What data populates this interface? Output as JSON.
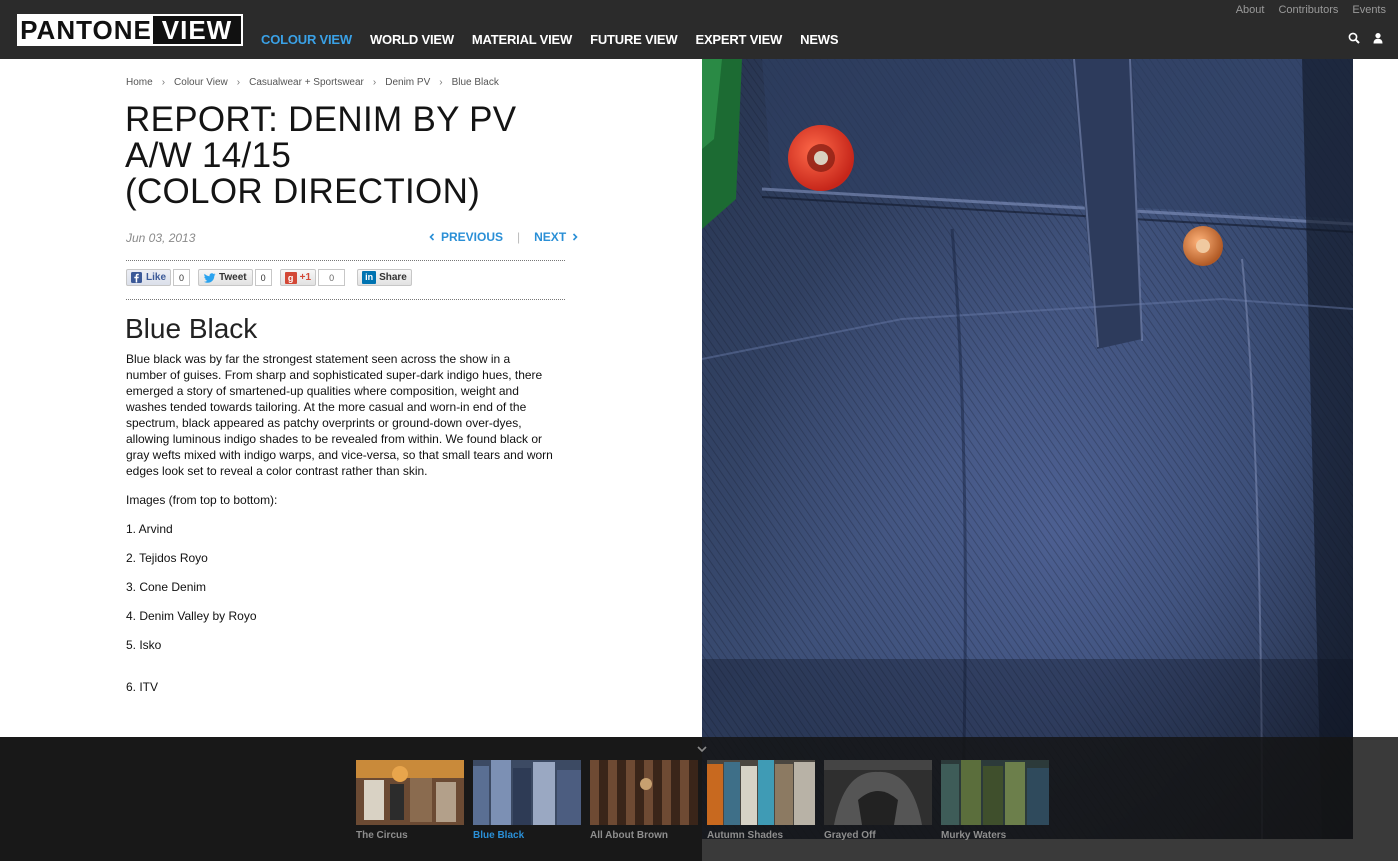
{
  "header": {
    "logo_left": "PANTONE",
    "logo_right": "VIEW",
    "nav": [
      {
        "label": "COLOUR VIEW",
        "active": true
      },
      {
        "label": "WORLD VIEW",
        "active": false
      },
      {
        "label": "MATERIAL VIEW",
        "active": false
      },
      {
        "label": "FUTURE VIEW",
        "active": false
      },
      {
        "label": "EXPERT VIEW",
        "active": false
      },
      {
        "label": "NEWS",
        "active": false
      }
    ],
    "util": [
      "About",
      "Contributors",
      "Events"
    ],
    "icons": [
      "search-icon",
      "user-icon"
    ]
  },
  "breadcrumb": [
    "Home",
    "Colour View",
    "Casualwear + Sportswear",
    "Denim PV",
    "Blue Black"
  ],
  "article": {
    "title_lines": [
      "REPORT: DENIM BY PV",
      "A/W 14/15",
      "(COLOR DIRECTION)"
    ],
    "date": "Jun 03, 2013",
    "previous_label": "PREVIOUS",
    "next_label": "NEXT",
    "section_title": "Blue Black",
    "body": "Blue black was by far the strongest statement seen across the show in a number of guises. From sharp and sophisticated super-dark indigo hues, there emerged a story of smartened-up qualities where composition, weight and washes tended towards tailoring. At the more casual and worn-in end of the spectrum, black appeared as patchy overprints or ground-down over-dyes, allowing luminous indigo shades to be revealed from within. We found black or gray wefts mixed with indigo warps, and vice-versa, so that small tears and worn edges look set to reveal a color contrast rather than skin.",
    "images_heading": "Images (from top to bottom):",
    "images_list": [
      "1. Arvind",
      "2. Tejidos Royo",
      "3. Cone Denim",
      "4. Denim Valley by Royo",
      "5. Isko",
      "6. ITV"
    ]
  },
  "share": {
    "like_label": "Like",
    "like_count": "0",
    "tweet_label": "Tweet",
    "tweet_count": "0",
    "plus_label": "+1",
    "plus_count": "0",
    "linkedin_label": "Share"
  },
  "gallery": {
    "items": [
      {
        "caption": "The Circus",
        "active": false
      },
      {
        "caption": "Blue Black",
        "active": true
      },
      {
        "caption": "All About Brown",
        "active": false
      },
      {
        "caption": "Autumn Shades",
        "active": false
      },
      {
        "caption": "Grayed Off",
        "active": false
      },
      {
        "caption": "Murky Waters",
        "active": false
      }
    ]
  },
  "colors": {
    "accent": "#2a8fd6",
    "header_bg": "#2b2b2b"
  }
}
